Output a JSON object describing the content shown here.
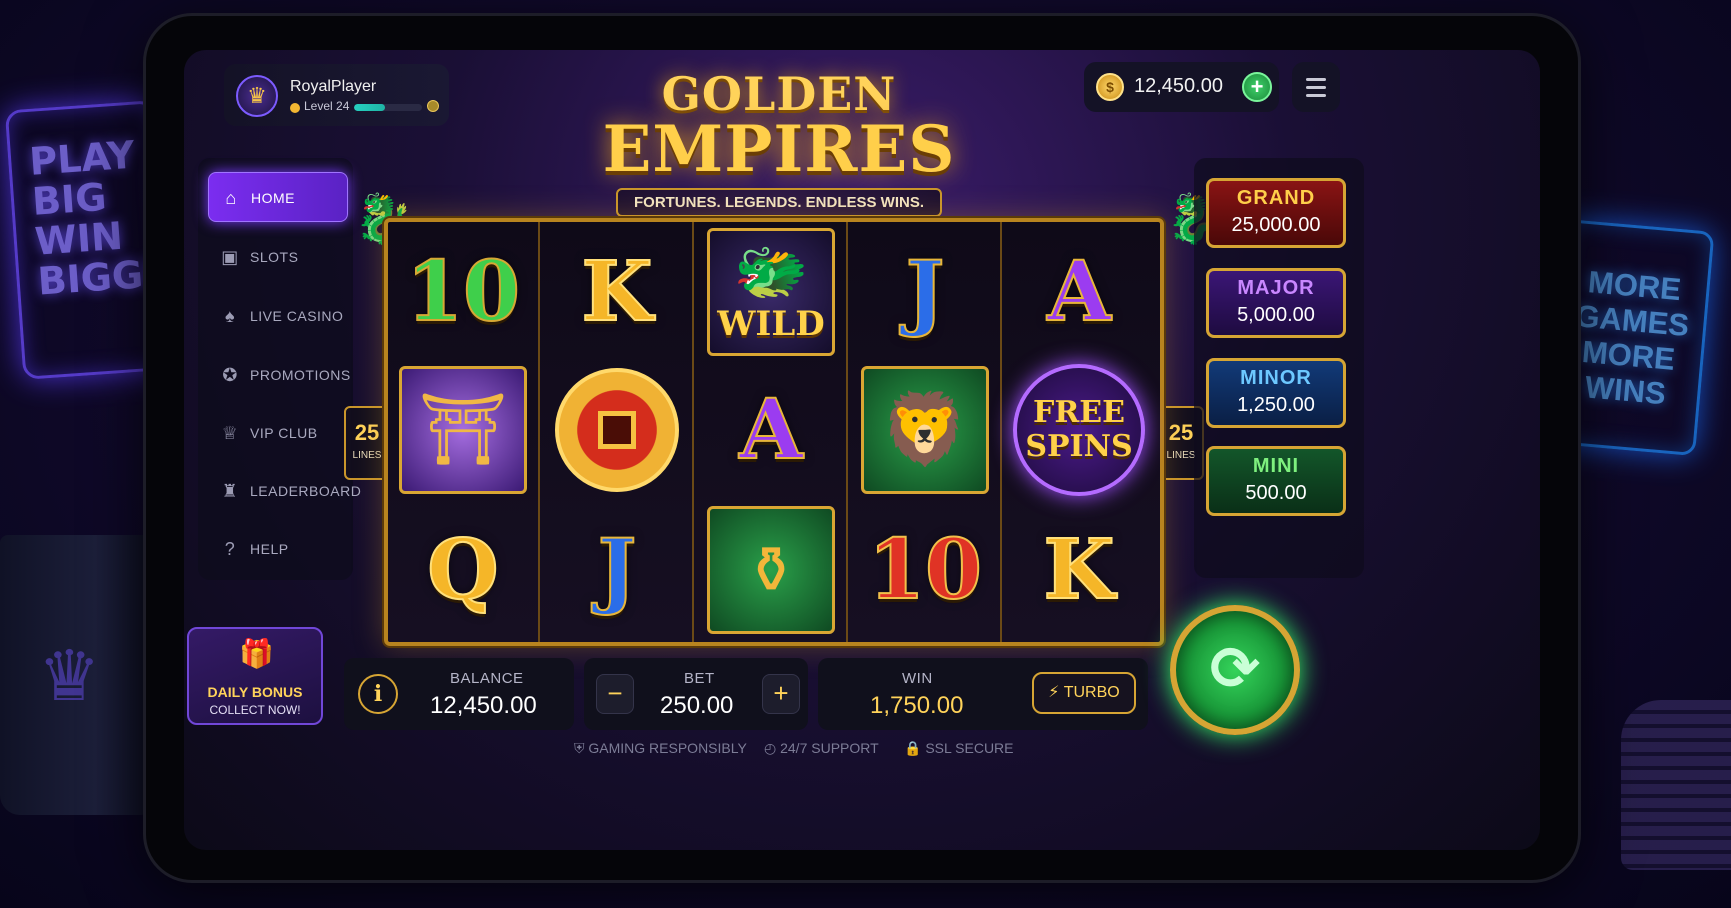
{
  "background": {
    "left_sign_lines": [
      "PLAY",
      "BIG",
      "WIN",
      "BIGGER"
    ],
    "right_sign_lines": [
      "MORE",
      "GAMES",
      "MORE",
      "WINS"
    ]
  },
  "profile": {
    "username": "RoyalPlayer",
    "level_label": "Level 24",
    "xp_progress": 0.45
  },
  "wallet": {
    "balance": "12,450.00",
    "add_label": "+"
  },
  "logo": {
    "line1": "GOLDEN",
    "line2": "EMPIRES",
    "tagline": "FORTUNES. LEGENDS. ENDLESS WINS."
  },
  "sidebar": {
    "items": [
      {
        "label": "HOME",
        "icon": "home-icon",
        "active": true
      },
      {
        "label": "SLOTS",
        "icon": "slots-icon",
        "active": false
      },
      {
        "label": "LIVE CASINO",
        "icon": "live-casino-icon",
        "active": false
      },
      {
        "label": "PROMOTIONS",
        "icon": "promotions-icon",
        "active": false
      },
      {
        "label": "VIP CLUB",
        "icon": "crown-icon",
        "active": false
      },
      {
        "label": "LEADERBOARD",
        "icon": "leaderboard-icon",
        "active": false
      },
      {
        "label": "HELP",
        "icon": "help-icon",
        "active": false
      }
    ]
  },
  "daily_bonus": {
    "title": "DAILY BONUS",
    "cta": "COLLECT NOW!"
  },
  "reels": {
    "lines_left": {
      "count": "25",
      "label": "LINES"
    },
    "lines_right": {
      "count": "25",
      "label": "LINES"
    },
    "columns": [
      [
        "10",
        "pagoda",
        "Q"
      ],
      [
        "K",
        "coin",
        "J"
      ],
      [
        "WILD",
        "A",
        "pot"
      ],
      [
        "J",
        "lion",
        "10"
      ],
      [
        "A",
        "FREE SPINS",
        "K"
      ]
    ],
    "wild_label": "WILD",
    "free_spins_line1": "FREE",
    "free_spins_line2": "SPINS"
  },
  "jackpots": [
    {
      "name": "GRAND",
      "value": "25,000.00"
    },
    {
      "name": "MAJOR",
      "value": "5,000.00"
    },
    {
      "name": "MINOR",
      "value": "1,250.00"
    },
    {
      "name": "MINI",
      "value": "500.00"
    }
  ],
  "controls": {
    "info_label": "i",
    "balance_caption": "BALANCE",
    "balance_value": "12,450.00",
    "bet_caption": "BET",
    "bet_value": "250.00",
    "minus_label": "−",
    "plus_label": "+",
    "win_caption": "WIN",
    "win_value": "1,750.00",
    "turbo_label": "TURBO"
  },
  "footer": {
    "responsible": "GAMING RESPONSIBLY",
    "support": "24/7 SUPPORT",
    "ssl": "SSL SECURE"
  },
  "colors": {
    "accent_purple": "#7b2df0",
    "gold": "#d6a534",
    "spin_green": "#34d35a"
  }
}
